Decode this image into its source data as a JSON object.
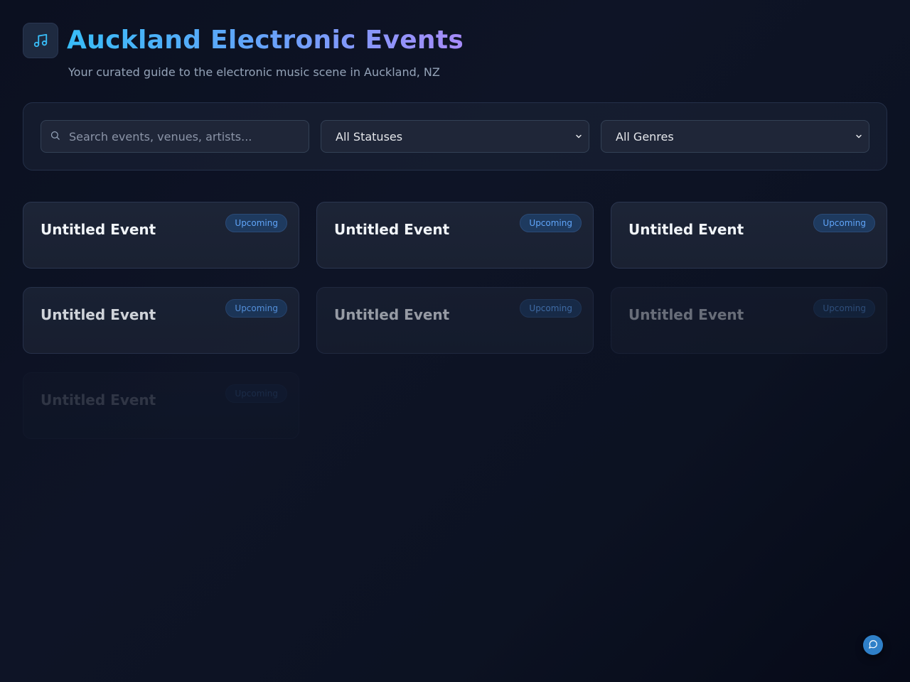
{
  "header": {
    "title": "Auckland Electronic Events",
    "subtitle": "Your curated guide to the electronic music scene in Auckland, NZ",
    "logo_icon": "music-note-icon"
  },
  "filters": {
    "search_placeholder": "Search events, venues, artists...",
    "status_selected": "All Statuses",
    "genre_selected": "All Genres"
  },
  "events": [
    {
      "title": "Untitled Event",
      "status": "Upcoming",
      "opacity": 1
    },
    {
      "title": "Untitled Event",
      "status": "Upcoming",
      "opacity": 1
    },
    {
      "title": "Untitled Event",
      "status": "Upcoming",
      "opacity": 1
    },
    {
      "title": "Untitled Event",
      "status": "Upcoming",
      "opacity": 0.85
    },
    {
      "title": "Untitled Event",
      "status": "Upcoming",
      "opacity": 0.6
    },
    {
      "title": "Untitled Event",
      "status": "Upcoming",
      "opacity": 0.4
    },
    {
      "title": "Untitled Event",
      "status": "Upcoming",
      "opacity": 0.15
    }
  ],
  "fab": {
    "icon": "chat-bubble-icon"
  },
  "colors": {
    "accent": "#38bdf8",
    "accent_purple": "#a78bfa",
    "badge_text": "#60a5fa",
    "fab": "#2f80c8"
  }
}
